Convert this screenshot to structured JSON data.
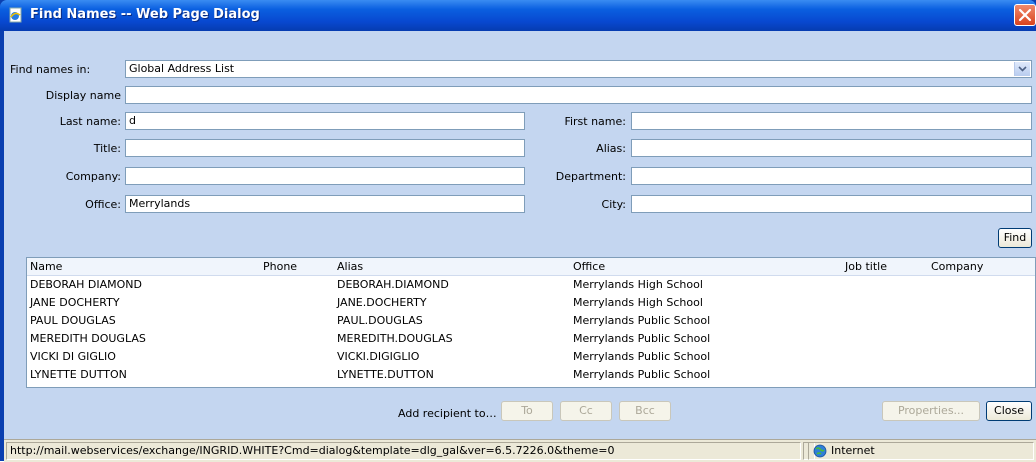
{
  "window": {
    "title": "Find Names -- Web Page Dialog"
  },
  "form": {
    "find_in_label": "Find names in:",
    "find_in_value": "Global Address List",
    "display_name_label": "Display name",
    "display_name_value": "",
    "last_name_label": "Last name:",
    "last_name_value": "d",
    "first_name_label": "First name:",
    "first_name_value": "",
    "title_label": "Title:",
    "title_value": "",
    "alias_label": "Alias:",
    "alias_value": "",
    "company_label": "Company:",
    "company_value": "",
    "department_label": "Department:",
    "department_value": "",
    "office_label": "Office:",
    "office_value": "Merrylands",
    "city_label": "City:",
    "city_value": "",
    "find_button": "Find"
  },
  "results": {
    "columns": [
      "Name",
      "Phone",
      "Alias",
      "Office",
      "Job title",
      "Company"
    ],
    "rows": [
      [
        "DEBORAH DIAMOND",
        "",
        "DEBORAH.DIAMOND",
        "Merrylands High School",
        "",
        ""
      ],
      [
        "JANE DOCHERTY",
        "",
        "JANE.DOCHERTY",
        "Merrylands High School",
        "",
        ""
      ],
      [
        "PAUL DOUGLAS",
        "",
        "PAUL.DOUGLAS",
        "Merrylands Public School",
        "",
        ""
      ],
      [
        "MEREDITH DOUGLAS",
        "",
        "MEREDITH.DOUGLAS",
        "Merrylands Public School",
        "",
        ""
      ],
      [
        "VICKI DI GIGLIO",
        "",
        "VICKI.DIGIGLIO",
        "Merrylands Public School",
        "",
        ""
      ],
      [
        "LYNETTE DUTTON",
        "",
        "LYNETTE.DUTTON",
        "Merrylands Public School",
        "",
        ""
      ]
    ]
  },
  "actions": {
    "add_recipient_label": "Add recipient to…",
    "to_button": "To",
    "cc_button": "Cc",
    "bcc_button": "Bcc",
    "properties_button": "Properties...",
    "close_button": "Close"
  },
  "status": {
    "url": "http://mail.webservices/exchange/INGRID.WHITE?Cmd=dialog&template=dlg_gal&ver=6.5.7226.0&theme=0",
    "zone": "Internet"
  },
  "colors": {
    "titlebar": "#0a5fe0",
    "client_bg": "#c4d6f0",
    "close_button": "#d8431e"
  }
}
